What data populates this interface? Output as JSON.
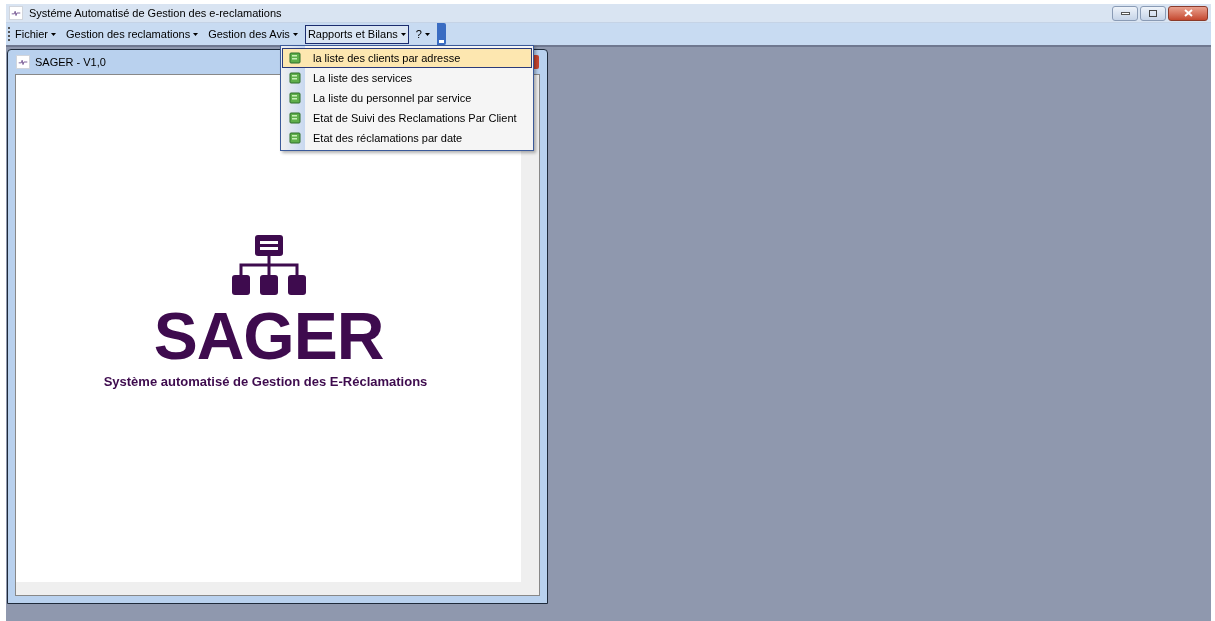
{
  "window": {
    "title": "Systéme Automatisé de Gestion des e-reclamations"
  },
  "menu_bar": [
    {
      "label": "Fichier",
      "selected": false
    },
    {
      "label": "Gestion des reclamations",
      "selected": false
    },
    {
      "label": "Gestion des Avis",
      "selected": false
    },
    {
      "label": "Rapports et Bilans",
      "selected": true
    },
    {
      "label": "?",
      "selected": false
    }
  ],
  "dropdown": [
    {
      "label": "la liste des clients par adresse",
      "selected": true
    },
    {
      "label": "La liste des services",
      "selected": false
    },
    {
      "label": "La liste du personnel par service",
      "selected": false
    },
    {
      "label": "Etat de Suivi des Reclamations Par Client",
      "selected": false
    },
    {
      "label": "Etat des réclamations par date",
      "selected": false
    }
  ],
  "child_window": {
    "title": "SAGER - V1,0",
    "logo": {
      "name": "SAGER",
      "subtitle": "Système automatisé de Gestion des E-Réclamations"
    }
  }
}
